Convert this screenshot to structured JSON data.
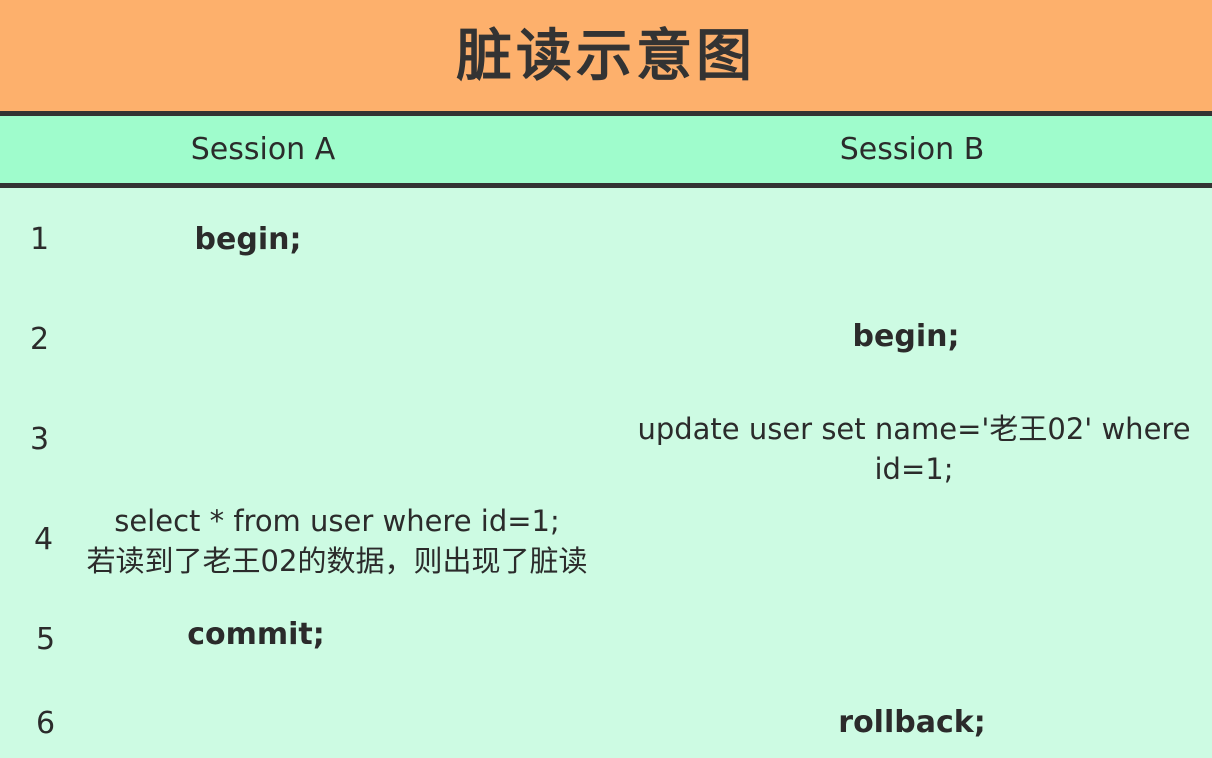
{
  "title": "脏读示意图",
  "columns": {
    "a": "Session A",
    "b": "Session B"
  },
  "rows": [
    {
      "num": "1",
      "a": "begin;",
      "b": ""
    },
    {
      "num": "2",
      "a": "",
      "b": "begin;"
    },
    {
      "num": "3",
      "a": "",
      "b_line1": "update user set name='老王02' where",
      "b_line2": "id=1;"
    },
    {
      "num": "4",
      "a_line1": "select * from user where id=1;",
      "a_line2": "若读到了老王02的数据，则出现了脏读",
      "b": ""
    },
    {
      "num": "5",
      "a": "commit;",
      "b": ""
    },
    {
      "num": "6",
      "a": "",
      "b": "rollback;"
    }
  ],
  "colors": {
    "title_bg": "#fdb06c",
    "header_bg": "#9ffccc",
    "body_bg": "#cdfbe3",
    "border": "#333333"
  }
}
